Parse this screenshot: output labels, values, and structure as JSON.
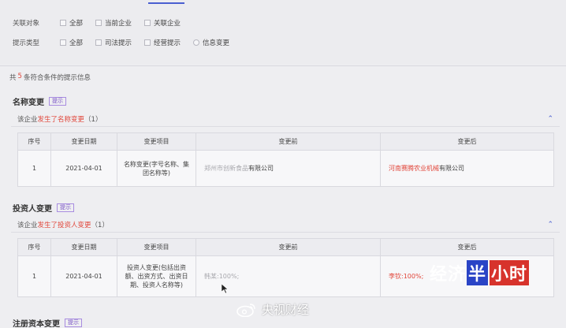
{
  "filters": {
    "related": {
      "label": "关联对象",
      "options": [
        "全部",
        "当前企业",
        "关联企业"
      ]
    },
    "prompt_type": {
      "label": "提示类型",
      "options": [
        "全部",
        "司法提示",
        "经营提示",
        "信息变更"
      ]
    }
  },
  "summary": {
    "prefix": "共",
    "count": "5",
    "suffix": "条符合条件的提示信息"
  },
  "sections": [
    {
      "title": "名称变更",
      "tag": "提示",
      "sub_prefix": "该企业",
      "sub_highlight": "发生了名称变更",
      "sub_count": "（1）",
      "headers": [
        "序号",
        "变更日期",
        "变更项目",
        "变更前",
        "变更后"
      ],
      "row": {
        "index": "1",
        "date": "2021-04-01",
        "item": "名称变更(字号名称、集团名称等)",
        "before_blur": "郑州市创新食品",
        "before_rest": "有限公司",
        "after_red": "河南赛腾农业机械",
        "after_rest": "有限公司"
      }
    },
    {
      "title": "投资人变更",
      "tag": "提示",
      "sub_prefix": "该企业",
      "sub_highlight": "发生了投资人变更",
      "sub_count": "（1）",
      "headers": [
        "序号",
        "变更日期",
        "变更项目",
        "变更前",
        "变更后"
      ],
      "row": {
        "index": "1",
        "date": "2021-04-01",
        "item": "投资人变更(包括出资额、出资方式、出资日期、投资人名称等)",
        "before_blur": "韩某:100%;",
        "after_red": "李钦:100%;"
      }
    },
    {
      "title": "注册资本变更",
      "tag": "提示"
    }
  ],
  "watermark": {
    "part1": "经济",
    "part2": "半",
    "part3": "小时"
  },
  "weibo": {
    "text": "央视财经"
  },
  "colors": {
    "accent": "#4a5fd0",
    "highlight": "#e1463a",
    "tag": "#7a54c6"
  }
}
